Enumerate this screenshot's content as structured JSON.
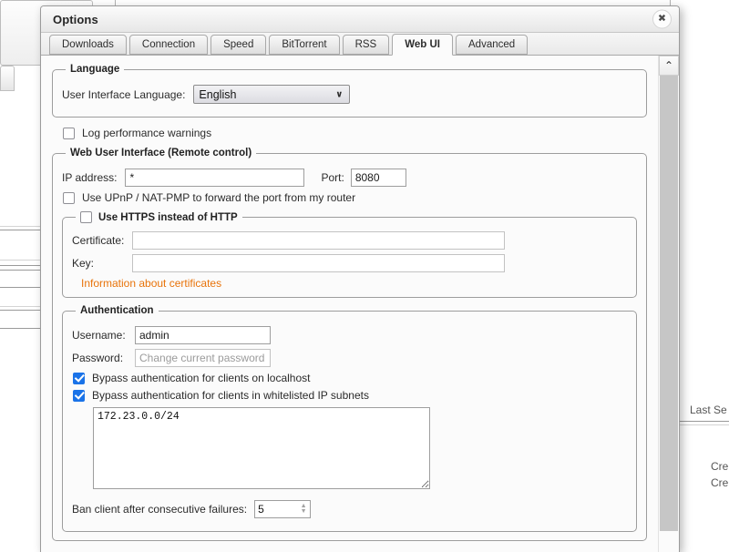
{
  "dialog": {
    "title": "Options",
    "close_label": "✖",
    "tabs": [
      {
        "label": "Downloads",
        "active": false
      },
      {
        "label": "Connection",
        "active": false
      },
      {
        "label": "Speed",
        "active": false
      },
      {
        "label": "BitTorrent",
        "active": false
      },
      {
        "label": "RSS",
        "active": false
      },
      {
        "label": "Web UI",
        "active": true
      },
      {
        "label": "Advanced",
        "active": false
      }
    ]
  },
  "language": {
    "legend": "Language",
    "ui_language_label": "User Interface Language:",
    "ui_language_value": "English",
    "chevron": "∨"
  },
  "log_perf": {
    "label": "Log performance warnings",
    "checked": false
  },
  "webui": {
    "legend": "Web User Interface (Remote control)",
    "ip_label": "IP address:",
    "ip_value": "*",
    "port_label": "Port:",
    "port_value": "8080",
    "upnp_label": "Use UPnP / NAT-PMP to forward the port from my router",
    "upnp_checked": false
  },
  "https": {
    "legend": "Use HTTPS instead of HTTP",
    "checked": false,
    "certificate_label": "Certificate:",
    "certificate_value": "",
    "key_label": "Key:",
    "key_value": "",
    "info_link": "Information about certificates"
  },
  "auth": {
    "legend": "Authentication",
    "username_label": "Username:",
    "username_value": "admin",
    "password_label": "Password:",
    "password_placeholder": "Change current password",
    "bypass_localhost_label": "Bypass authentication for clients on localhost",
    "bypass_localhost_checked": true,
    "bypass_subnets_label": "Bypass authentication for clients in whitelisted IP subnets",
    "bypass_subnets_checked": true,
    "subnets_value": "172.23.0.0/24",
    "ban_label": "Ban client after consecutive failures:",
    "ban_value": "5",
    "spin_up": "▲",
    "spin_down": "▼"
  },
  "scrollbar": {
    "up_arrow": "⌃"
  },
  "background": {
    "column_header": "Last Se",
    "row_1": "Cre",
    "row_2": "Cre"
  },
  "colors": {
    "accent_checkbox": "#1a73e8",
    "link_orange": "#e8730a",
    "dialog_bg": "#fbfbfb",
    "titlebar_top": "#fbfbfb"
  }
}
